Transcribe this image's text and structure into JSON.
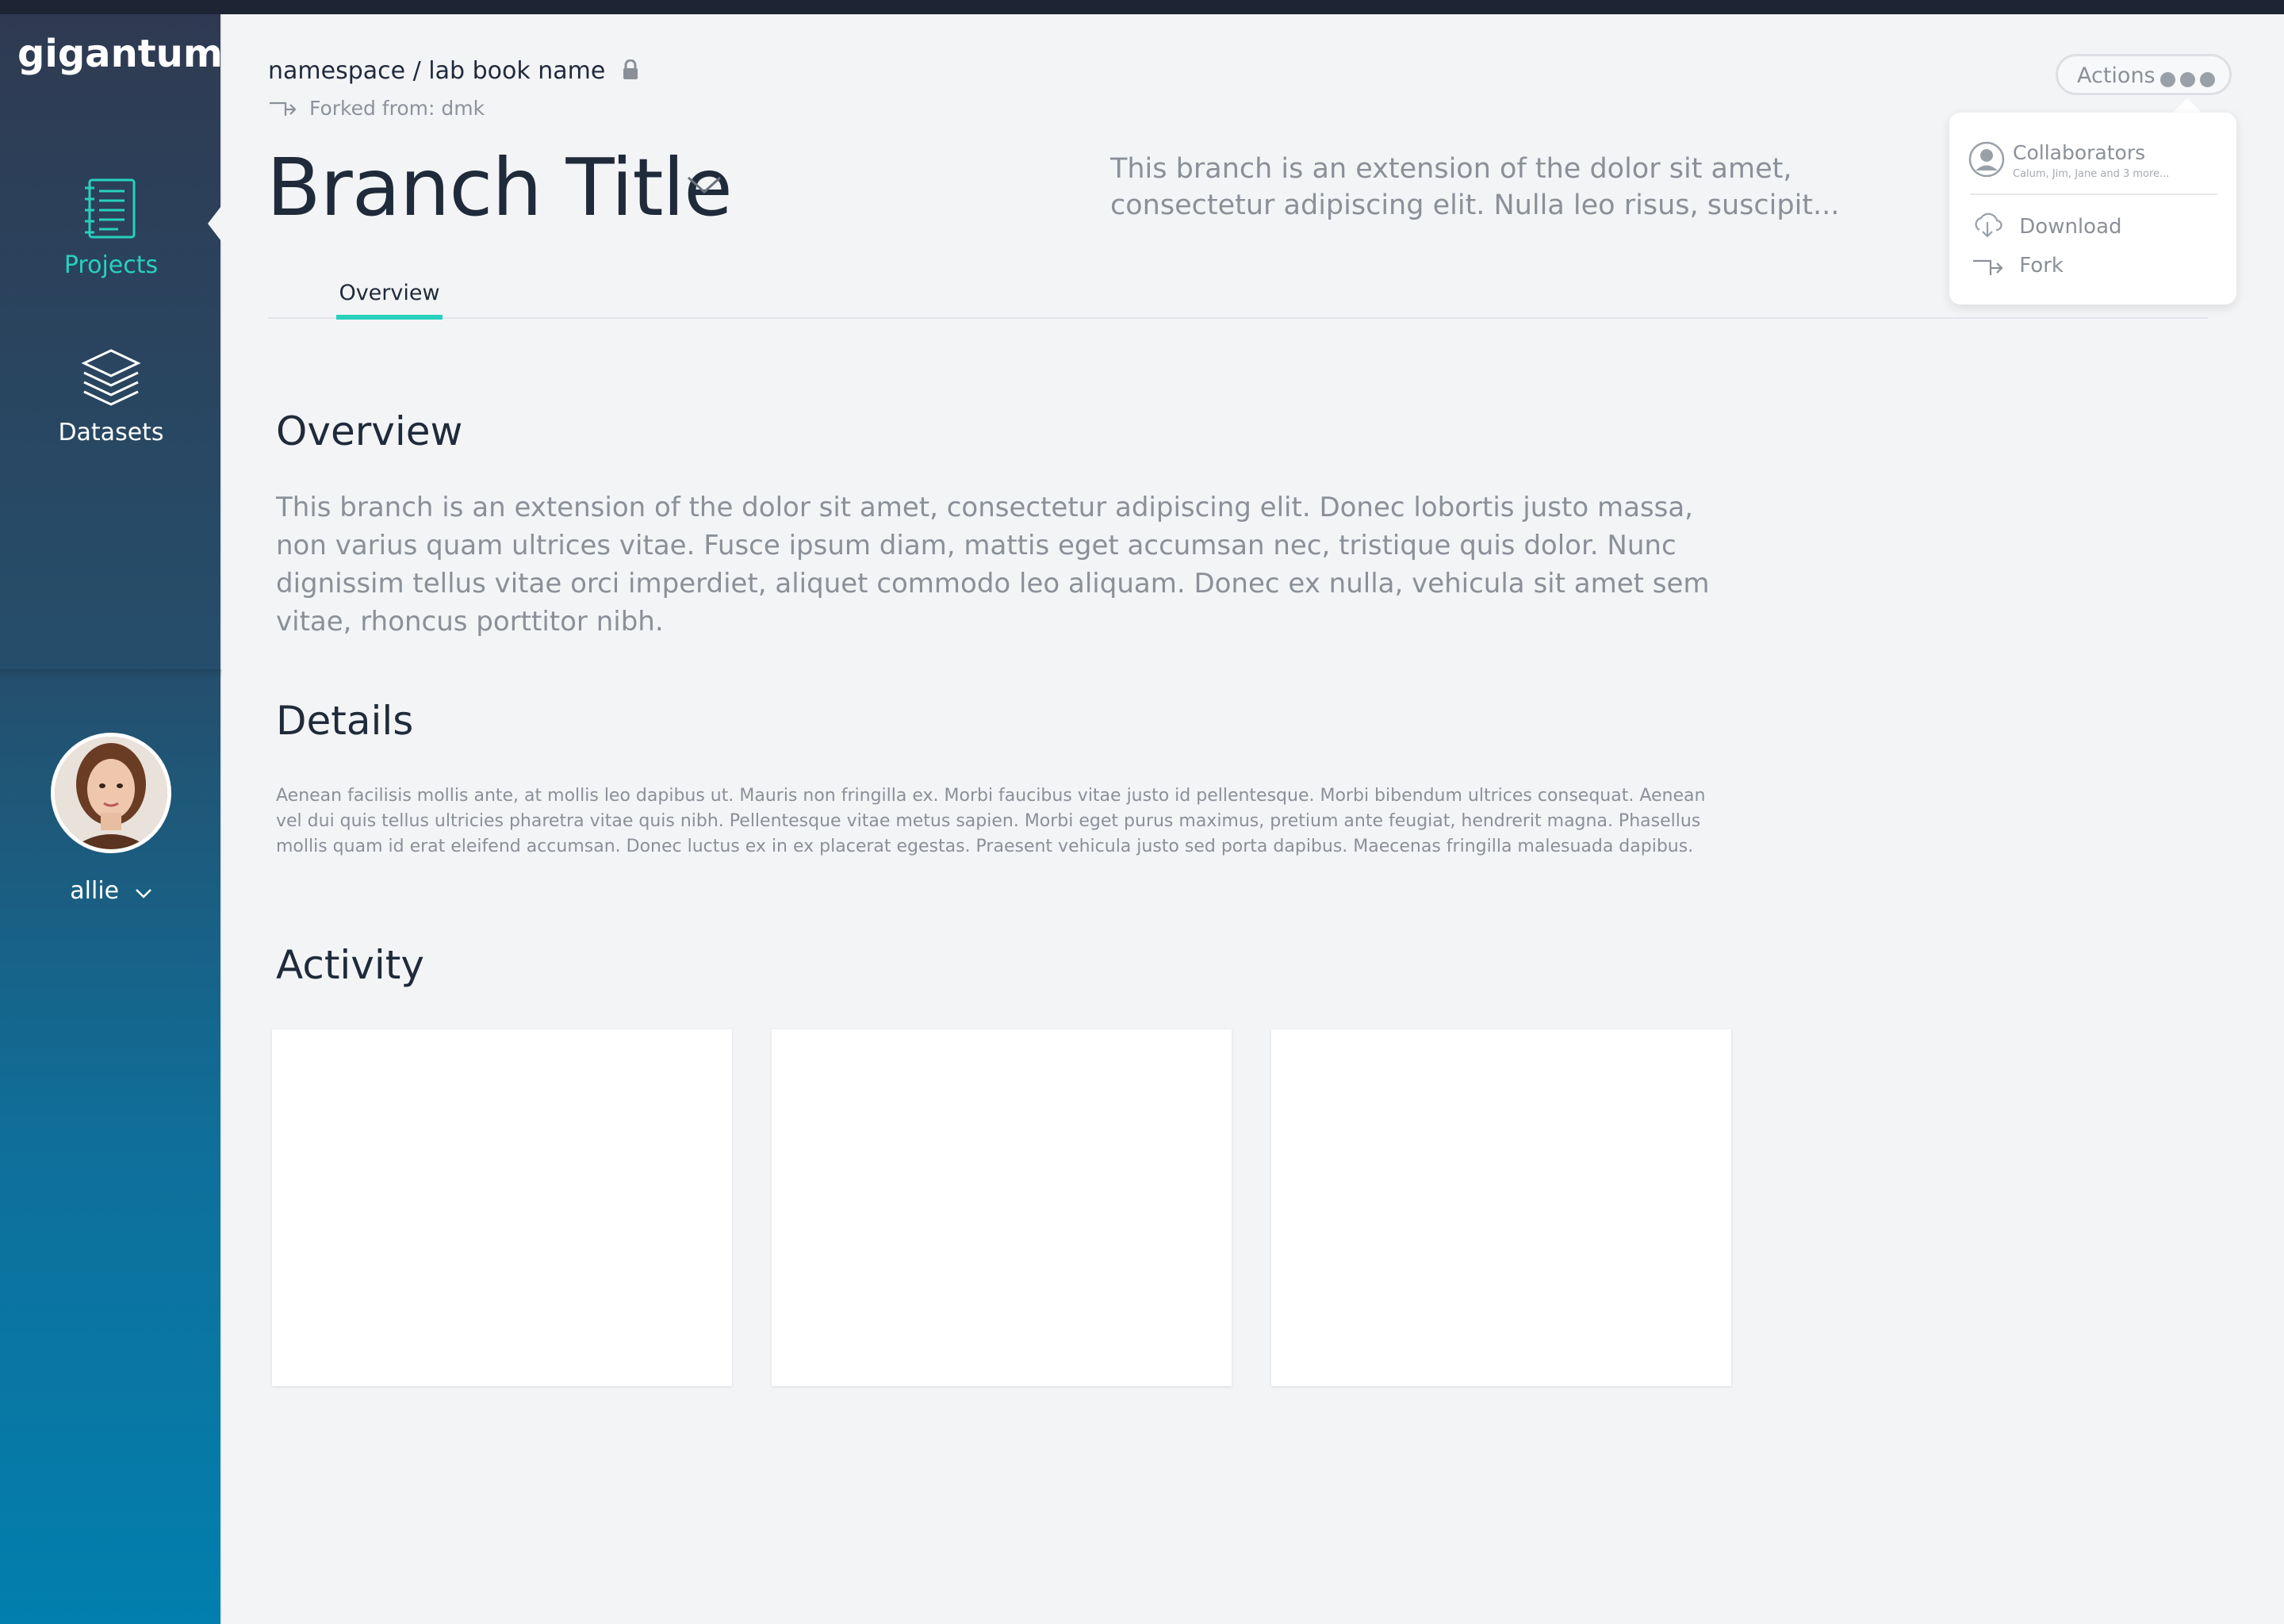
{
  "app": {
    "brand": "gigantum"
  },
  "sidebar": {
    "items": [
      {
        "label": "Projects",
        "icon": "notebook-icon",
        "active": true
      },
      {
        "label": "Datasets",
        "icon": "layers-icon",
        "active": false
      }
    ],
    "user": {
      "name": "allie",
      "avatar": "avatar-photo"
    }
  },
  "header": {
    "breadcrumb": "namespace / lab book name",
    "forked_from": "Forked from: dmk",
    "title": "Branch Title",
    "description": "This branch is an extension of the dolor sit amet, consectetur adipiscing elit. Nulla leo risus, suscipit..."
  },
  "tabs": [
    {
      "label": "Overview",
      "active": true
    }
  ],
  "sections": {
    "overview": {
      "heading": "Overview",
      "text": "This branch is an extension of the dolor sit amet, consectetur adipiscing elit. Donec lobortis justo massa, non varius quam ultrices vitae. Fusce ipsum diam, mattis eget accumsan nec, tristique quis dolor. Nunc dignissim tellus vitae orci imperdiet, aliquet commodo leo aliquam. Donec ex nulla, vehicula sit amet sem vitae, rhoncus porttitor nibh."
    },
    "details": {
      "heading": "Details",
      "text": "Aenean facilisis mollis ante, at mollis leo dapibus ut. Mauris non fringilla ex. Morbi faucibus vitae justo id pellentesque. Morbi bibendum ultrices consequat. Aenean vel dui quis tellus ultricies pharetra vitae quis nibh. Pellentesque vitae metus sapien. Morbi eget purus maximus, pretium ante feugiat, hendrerit magna. Phasellus mollis quam id erat eleifend accumsan. Donec luctus ex in ex placerat egestas. Praesent vehicula justo sed porta dapibus. Maecenas fringilla malesuada dapibus."
    },
    "activity": {
      "heading": "Activity",
      "card_count": 3
    }
  },
  "actions": {
    "label": "Actions",
    "menu": {
      "collaborators": {
        "label": "Collaborators",
        "names": "Calum, Jim, Jane and 3 more..."
      },
      "download": "Download",
      "fork": "Fork"
    }
  },
  "colors": {
    "accent": "#27d1bd",
    "sidebar_top": "#2f3a52",
    "sidebar_bottom": "#027fae",
    "text_dark": "#1f2a3a",
    "text_muted": "#8b9098"
  }
}
